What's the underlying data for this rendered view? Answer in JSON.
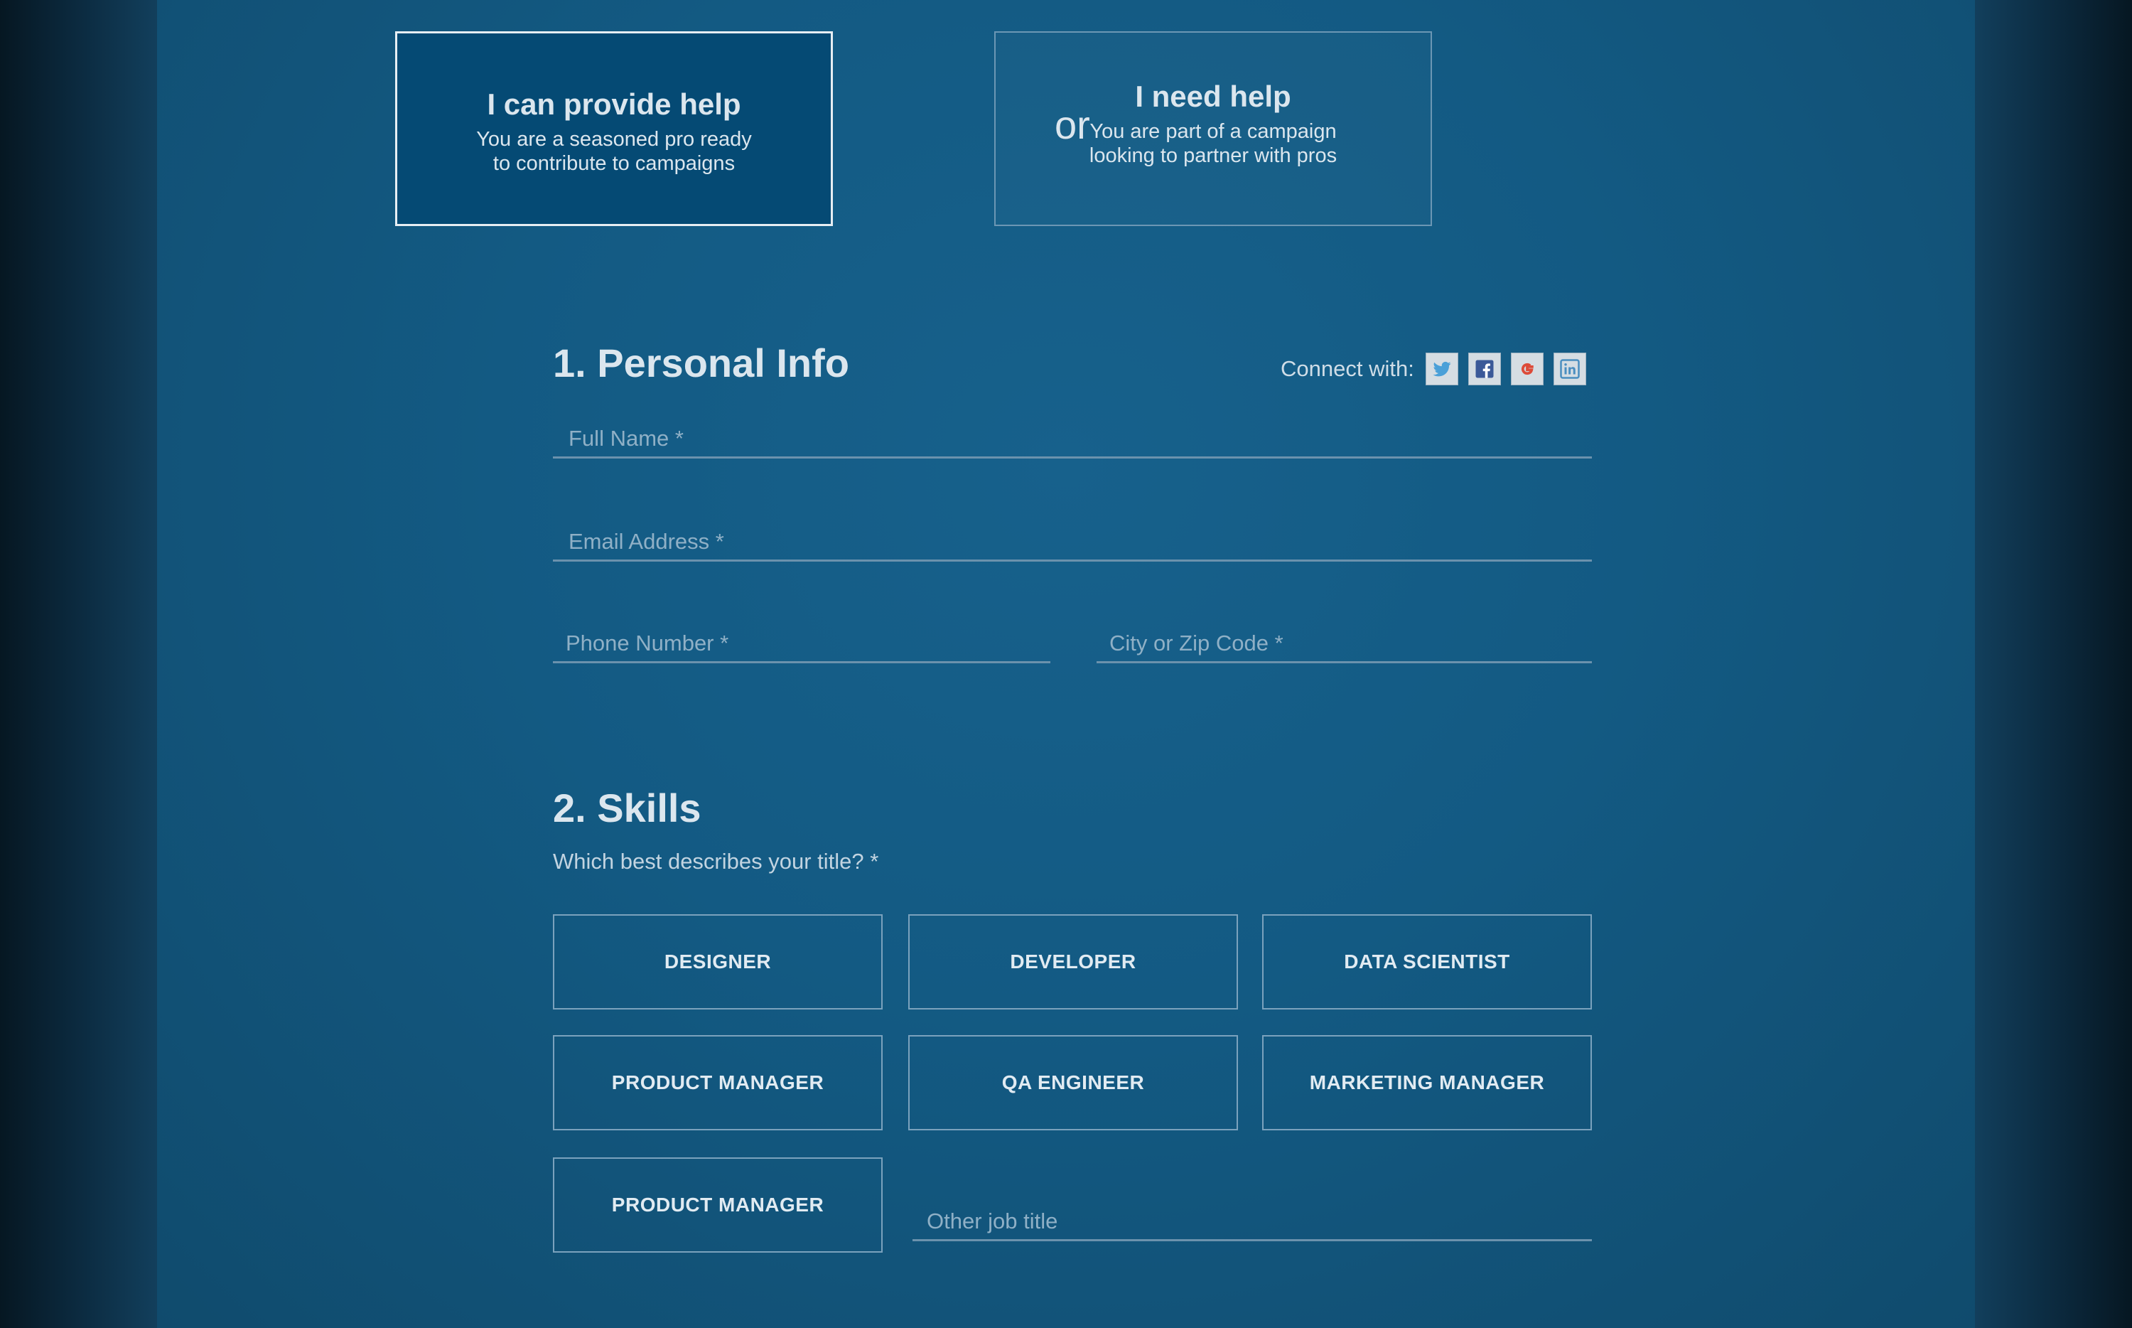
{
  "roles": {
    "provider": {
      "title": "I can provide help",
      "desc_line1": "You are a seasoned pro ready",
      "desc_line2": "to contribute to campaigns"
    },
    "or_text": "or",
    "seeker": {
      "title": "I need help",
      "desc_line1": "You are part of a campaign",
      "desc_line2": "looking to partner with pros"
    }
  },
  "personal_info": {
    "title": "1. Personal Info",
    "connect_label": "Connect with:",
    "social_icons": [
      "twitter-icon",
      "facebook-icon",
      "google-icon",
      "linkedin-icon"
    ],
    "full_name": {
      "placeholder": "Full Name *",
      "value": ""
    },
    "email": {
      "placeholder": "Email Address *",
      "value": ""
    },
    "phone": {
      "placeholder": "Phone Number *",
      "value": ""
    },
    "city_zip": {
      "placeholder": "City or Zip Code *",
      "value": ""
    }
  },
  "skills": {
    "title": "2. Skills",
    "question": "Which best describes your title? *",
    "options": [
      "DESIGNER",
      "DEVELOPER",
      "DATA SCIENTIST",
      "PRODUCT MANAGER",
      "QA ENGINEER",
      "MARKETING MANAGER",
      "PRODUCT MANAGER"
    ],
    "other": {
      "placeholder": "Other job title",
      "value": ""
    }
  },
  "colors": {
    "active_card": "#054a74",
    "panel": "#135a83",
    "text": "#dbe6ee",
    "twitter": "#4aa0d8",
    "facebook": "#3b5998",
    "google": "#dd4b39",
    "linkedin": "#4a8ec0"
  }
}
